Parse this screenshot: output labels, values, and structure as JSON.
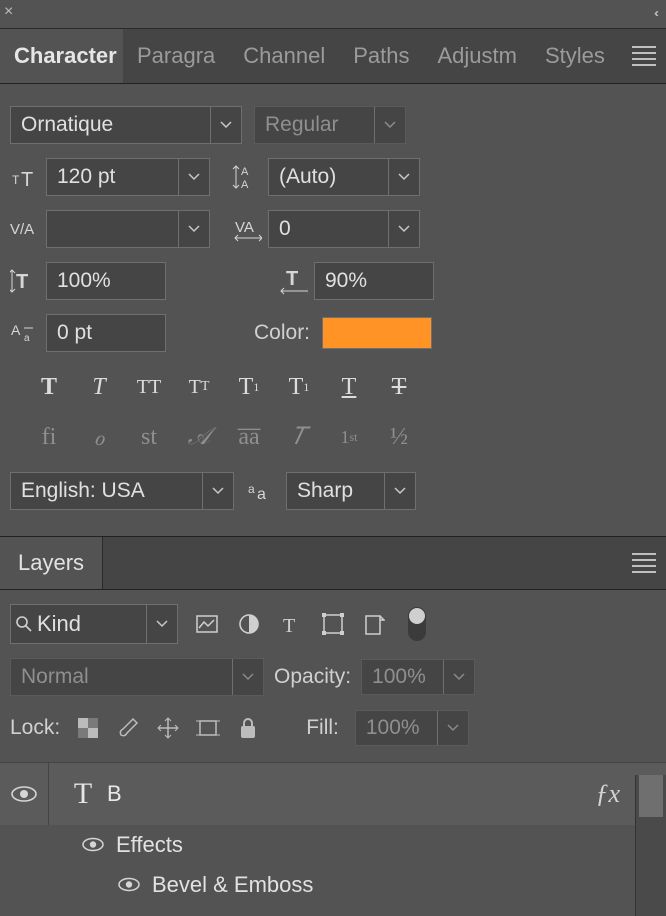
{
  "tabs": {
    "labels": [
      "Character",
      "Paragra",
      "Channel",
      "Paths",
      "Adjustm",
      "Styles"
    ]
  },
  "character": {
    "font_family": "Ornatique",
    "font_style": "Regular",
    "font_size": "120 pt",
    "leading": "(Auto)",
    "kerning": "",
    "tracking": "0",
    "vscale": "100%",
    "hscale": "90%",
    "baseline": "0 pt",
    "color_label": "Color:",
    "color_value": "#ff9326",
    "language": "English: USA",
    "aa_mode": "Sharp",
    "ot_labels": {
      "fi": "fi",
      "swash": "ℴ",
      "style": "st",
      "titling": "𝒜",
      "aa": "aa",
      "T": "𝑇",
      "ord": "1st",
      "frac": "½"
    }
  },
  "layers": {
    "tab": "Layers",
    "filter": "Kind",
    "blend_mode": "Normal",
    "opacity_label": "Opacity:",
    "opacity": "100%",
    "lock_label": "Lock:",
    "fill_label": "Fill:",
    "fill": "100%",
    "type_layer_name": "B",
    "effects_label": "Effects",
    "effect1": "Bevel & Emboss"
  }
}
